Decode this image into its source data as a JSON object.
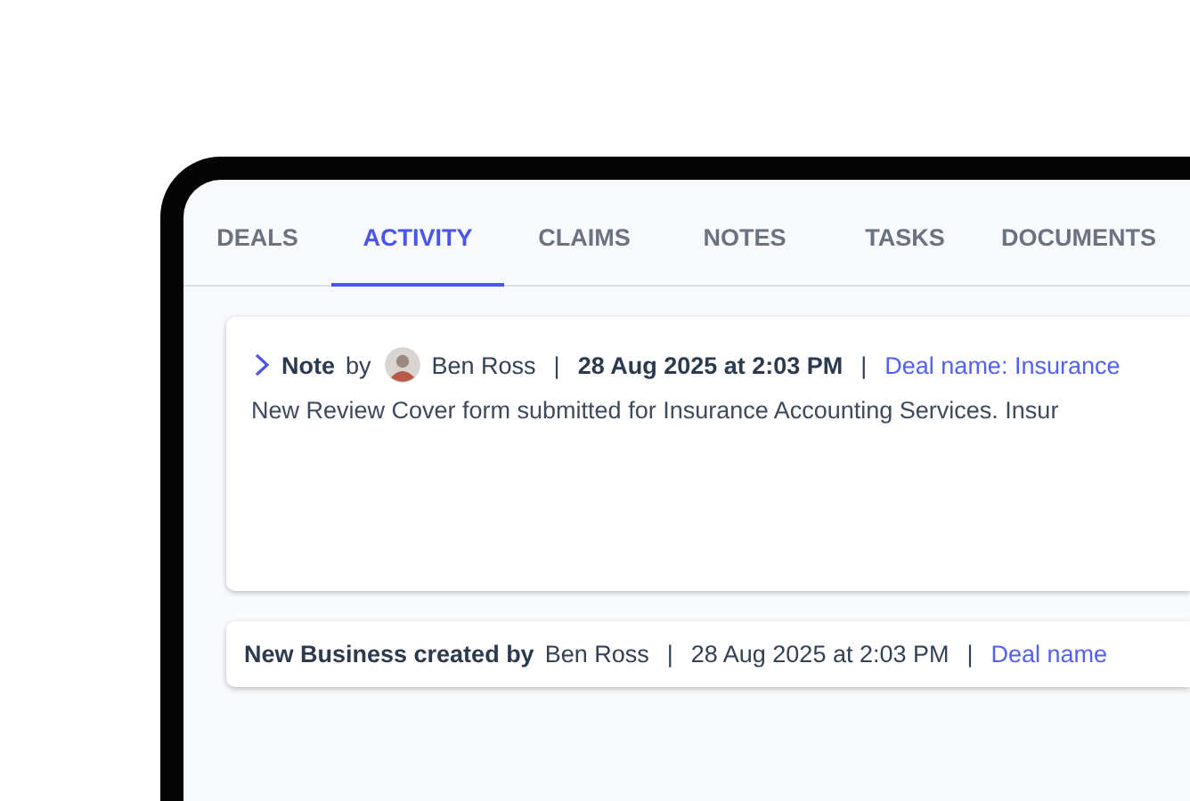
{
  "tabs": [
    {
      "label": "DEALS",
      "selected": false
    },
    {
      "label": "ACTIVITY",
      "selected": true
    },
    {
      "label": "CLAIMS",
      "selected": false
    },
    {
      "label": "NOTES",
      "selected": false
    },
    {
      "label": "TASKS",
      "selected": false
    },
    {
      "label": "DOCUMENTS",
      "selected": false
    }
  ],
  "activities": [
    {
      "kind": "note",
      "title": "Note",
      "by": "by",
      "author": "Ben Ross",
      "separator": "|",
      "timestamp": "28 Aug 2025 at 2:03 PM",
      "deal_link": "Deal name: Insurance",
      "body": "New Review Cover form submitted for Insurance Accounting Services. Insur"
    },
    {
      "kind": "event",
      "title": "New Business created by",
      "author": "Ben Ross",
      "separator": "|",
      "timestamp": "28 Aug 2025 at 2:03 PM",
      "deal_link": "Deal name"
    }
  ]
}
